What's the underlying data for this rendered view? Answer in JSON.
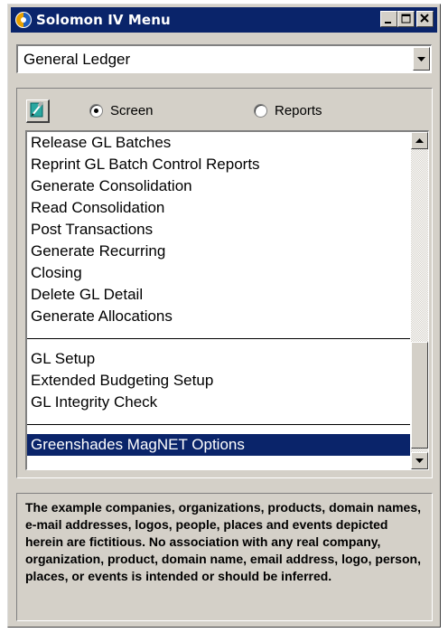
{
  "window": {
    "title": "Solomon IV Menu",
    "icon": "solomon-app-icon",
    "controls": [
      "minimize-icon",
      "maximize-icon",
      "close-icon"
    ]
  },
  "module_select": {
    "value": "General Ledger"
  },
  "view_mode": {
    "options": [
      {
        "label": "Screen",
        "selected": true
      },
      {
        "label": "Reports",
        "selected": false
      }
    ]
  },
  "toolbar": {
    "open_icon": "open-screen-icon"
  },
  "menu_list": {
    "group1": [
      "Release GL Batches",
      "Reprint GL Batch Control Reports",
      "Generate Consolidation",
      "Read Consolidation",
      "Post Transactions",
      "Generate Recurring",
      "Closing",
      "Delete GL Detail",
      "Generate Allocations"
    ],
    "group2": [
      "GL Setup",
      "Extended Budgeting Setup",
      "GL Integrity Check"
    ],
    "group3": [
      "Greenshades MagNET Options"
    ],
    "selected": "Greenshades MagNET Options"
  },
  "disclaimer": {
    "text": "The example companies, organizations, products, domain names, e-mail addresses, logos, people, places and events depicted herein are fictitious. No association with any real company, organization, product, domain name, email address, logo, person, places, or events is intended or should be inferred."
  },
  "colors": {
    "titlebar": "#0a246a",
    "face": "#d4d0c8",
    "selection": "#0a246a"
  }
}
